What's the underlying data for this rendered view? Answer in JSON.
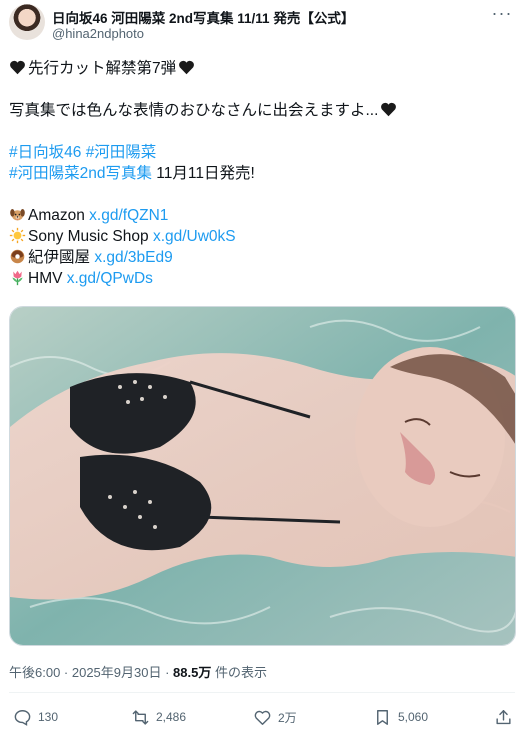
{
  "header": {
    "display_name": "日向坂46 河田陽菜 2nd写真集 11/11 発売【公式】",
    "handle": "@hina2ndphoto",
    "more_glyph": "···"
  },
  "post": {
    "line1": "先行カット解禁第7弾",
    "line2": "写真集では色んな表情のおひなさんに出会えますよ...",
    "hashtag1": "#日向坂46",
    "hashtag2": "#河田陽菜",
    "hashtag3": "#河田陽菜2nd写真集",
    "release_text": " 11月11日発売!",
    "shops": [
      {
        "icon": "dog-emoji",
        "label": "Amazon ",
        "link": "x.gd/fQZN1"
      },
      {
        "icon": "sun-emoji",
        "label": "Sony Music Shop ",
        "link": "x.gd/Uw0kS"
      },
      {
        "icon": "donut-emoji",
        "label": "紀伊國屋 ",
        "link": "x.gd/3bEd9"
      },
      {
        "icon": "tulip-emoji",
        "label": "HMV ",
        "link": "x.gd/QPwDs"
      }
    ]
  },
  "meta": {
    "time": "午後6:00 · 2025年9月30日 · ",
    "views": "88.5万",
    "views_suffix": " 件の表示"
  },
  "actions": {
    "replies": "130",
    "reposts": "2,486",
    "likes": "2万",
    "bookmarks": "5,060"
  },
  "colors": {
    "accent": "#1d9bf0",
    "secondary_text": "#536471"
  }
}
